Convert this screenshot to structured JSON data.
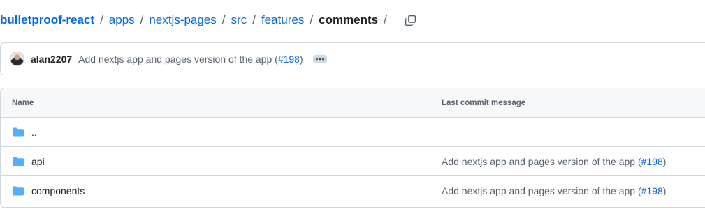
{
  "breadcrumb": {
    "repo": "bulletproof-react",
    "items": [
      "apps",
      "nextjs-pages",
      "src",
      "features"
    ],
    "current": "comments",
    "separator": "/"
  },
  "commit": {
    "author": "alan2207",
    "message": "Add nextjs app and pages version of the app (",
    "pr": "#198",
    "message_end": ")"
  },
  "table": {
    "headers": {
      "name": "Name",
      "last_commit": "Last commit message"
    },
    "rows": [
      {
        "name": "..",
        "icon": "folder-icon",
        "message": "",
        "pr": "",
        "message_end": "",
        "message_start": ""
      },
      {
        "name": "api",
        "icon": "folder-icon",
        "message_start": "Add nextjs app and pages version of the app (",
        "pr": "#198",
        "message_end": ")"
      },
      {
        "name": "components",
        "icon": "folder-icon",
        "message_start": "Add nextjs app and pages version of the app (",
        "pr": "#198",
        "message_end": ")"
      }
    ]
  },
  "colors": {
    "link": "#0969da",
    "folder": "#54aeff",
    "border": "#d1d9e0",
    "muted": "#59636e"
  }
}
